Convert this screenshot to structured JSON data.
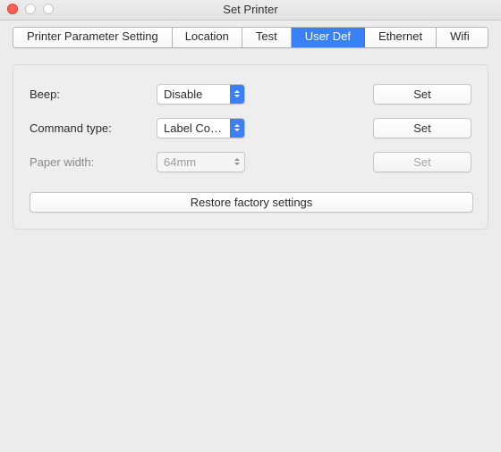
{
  "window": {
    "title": "Set Printer"
  },
  "tabs": [
    "Printer Parameter Setting",
    "Location",
    "Test",
    "User Def",
    "Ethernet",
    "Wifi"
  ],
  "selected_tab_index": 3,
  "rows": {
    "beep": {
      "label": "Beep:",
      "value": "Disable",
      "button": "Set"
    },
    "cmdtype": {
      "label": "Command type:",
      "value": "Label Co…",
      "button": "Set"
    },
    "paperwidth": {
      "label": "Paper width:",
      "value": "64mm",
      "button": "Set"
    }
  },
  "restore_label": "Restore factory settings"
}
